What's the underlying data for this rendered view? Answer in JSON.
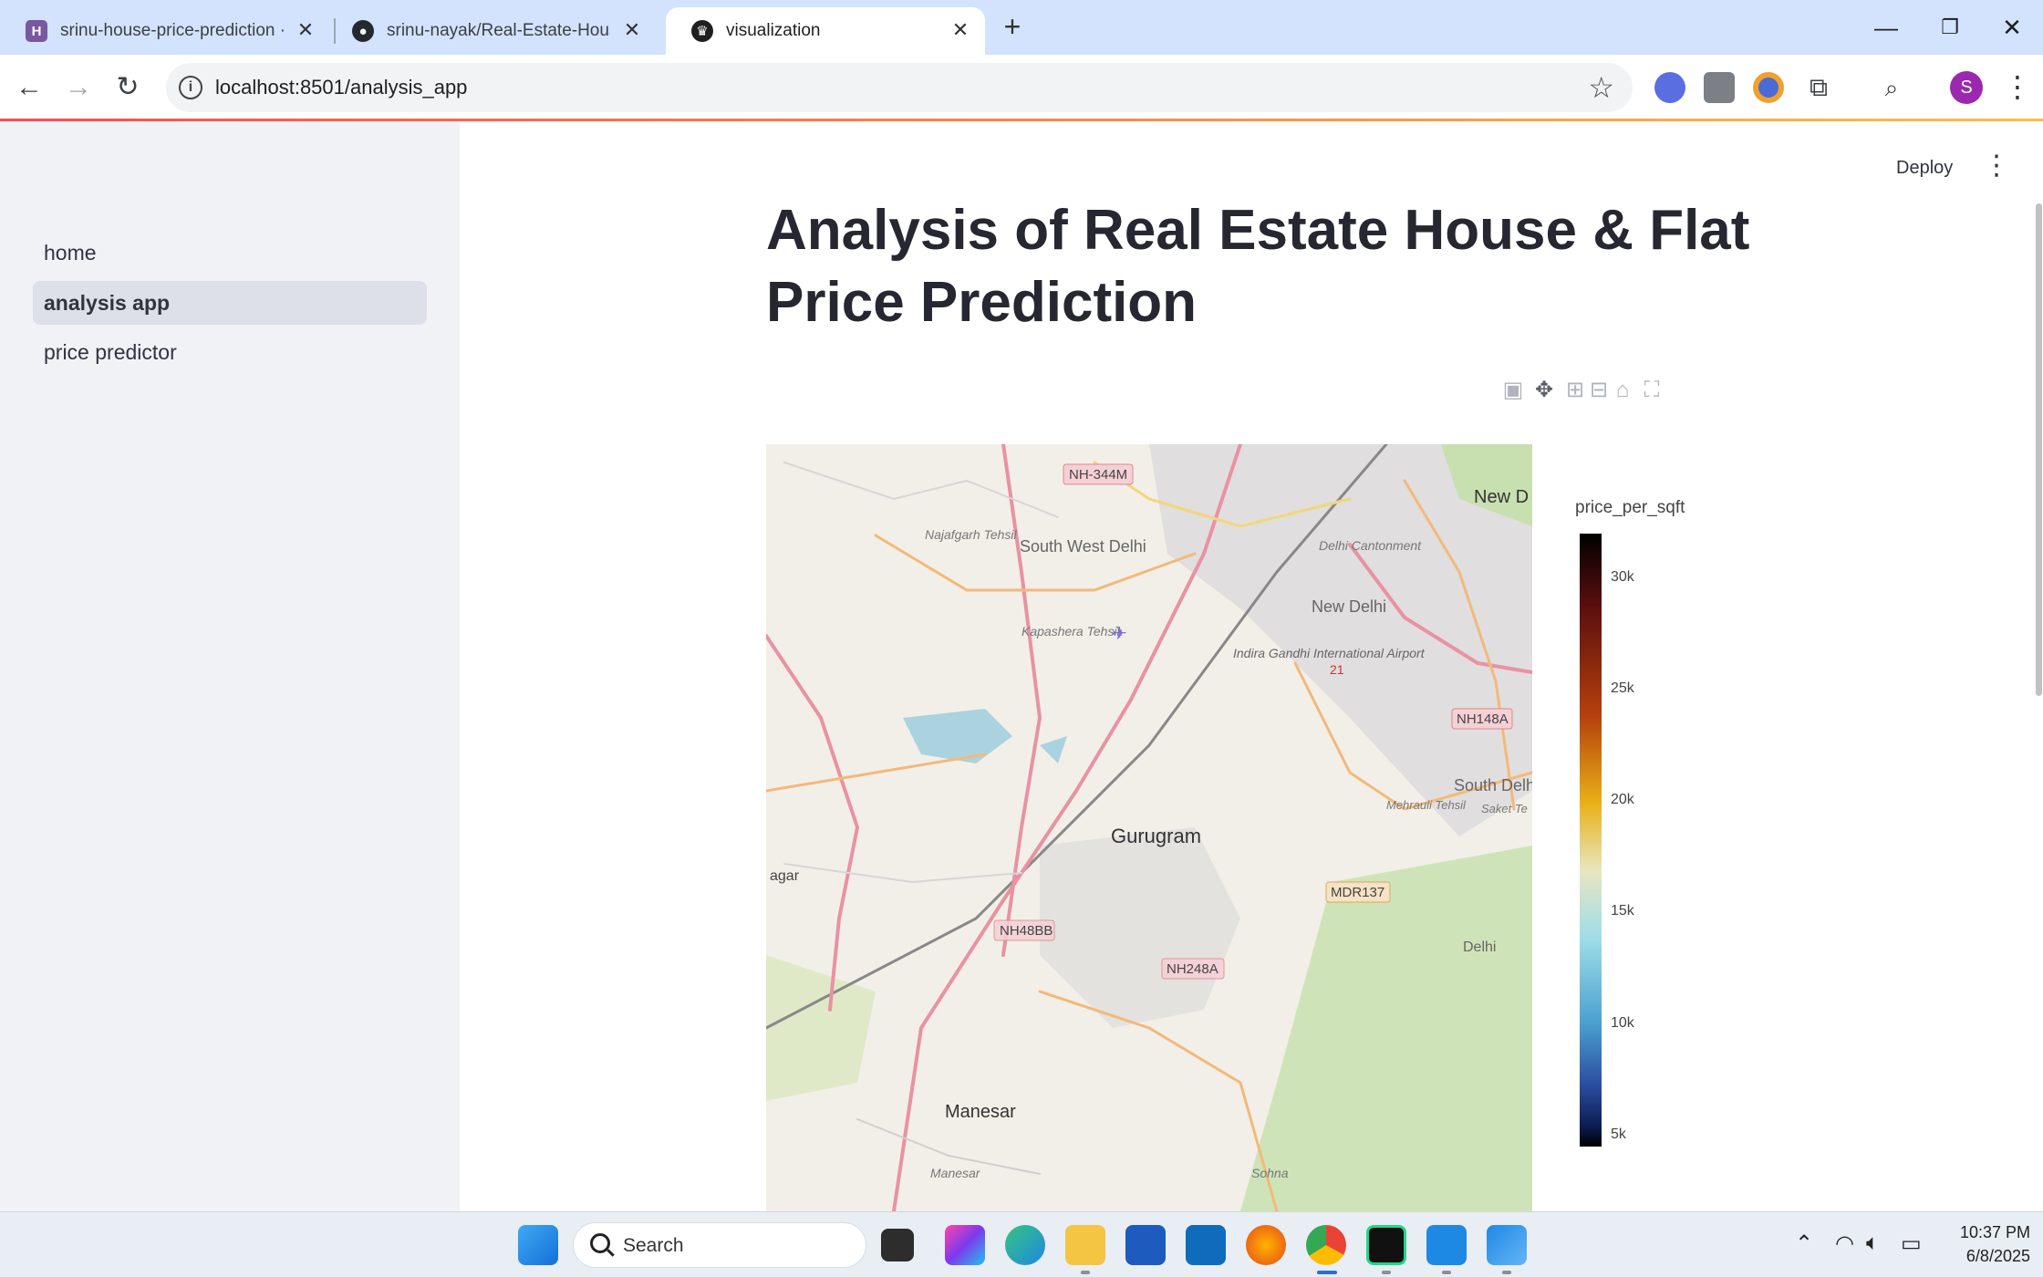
{
  "browser": {
    "tabs": [
      {
        "title": "srinu-house-price-prediction · H",
        "icon": "heroku-icon",
        "active": false
      },
      {
        "title": "srinu-nayak/Real-Estate-House",
        "icon": "github-icon",
        "active": false
      },
      {
        "title": "visualization",
        "icon": "streamlit-crown-icon",
        "active": true
      }
    ],
    "url": "localhost:8501/analysis_app",
    "profile_initial": "S"
  },
  "sidebar": {
    "items": [
      {
        "label": "home",
        "active": false
      },
      {
        "label": "analysis app",
        "active": true
      },
      {
        "label": "price predictor",
        "active": false
      }
    ]
  },
  "header": {
    "deploy_label": "Deploy"
  },
  "page": {
    "title": "Analysis of Real Estate House & Flat Price Prediction"
  },
  "plot": {
    "modebar_icons": [
      "camera-icon",
      "pan-icon",
      "zoom-in-icon",
      "zoom-out-icon",
      "home-icon",
      "fullscreen-icon"
    ],
    "map_labels": {
      "nh344m": "NH-344M",
      "new_delhi_top": "New D",
      "najafgarh": "Najafgarh Tehsil",
      "south_west_delhi": "South West Delhi",
      "delhi_cantonment": "Delhi Cantonment",
      "new_delhi": "New Delhi",
      "kapashera": "Kapashera Tehsil",
      "airport": "Indira Gandhi International Airport",
      "nh148a": "NH148A",
      "south_delhi": "South Delh",
      "saket": "Saket Te",
      "mehrauli": "Mehrauli Tehsil",
      "gurugram": "Gurugram",
      "mdr137": "MDR137",
      "nagar": "agar",
      "nh48bb": "NH48BB",
      "nh248a": "NH248A",
      "manesar": "Manesar",
      "manesar_tehsil": "Manesar",
      "sohna": "Sohna",
      "delhi_right": "Delhi",
      "road_21": "21"
    },
    "colorbar": {
      "title": "price_per_sqft",
      "ticks": [
        "30k",
        "25k",
        "20k",
        "15k",
        "10k",
        "5k"
      ],
      "tick_values": [
        30000,
        25000,
        20000,
        15000,
        10000,
        5000
      ],
      "range": [
        4500,
        32000
      ]
    }
  },
  "chart_data": {
    "type": "scatter",
    "title": "",
    "xlabel": "",
    "ylabel": "",
    "color_field": "price_per_sqft",
    "color_range": [
      4500,
      32000
    ],
    "points_note": "",
    "points": []
  },
  "taskbar": {
    "search_label": "Search",
    "time": "10:37 PM",
    "date": "6/8/2025"
  }
}
